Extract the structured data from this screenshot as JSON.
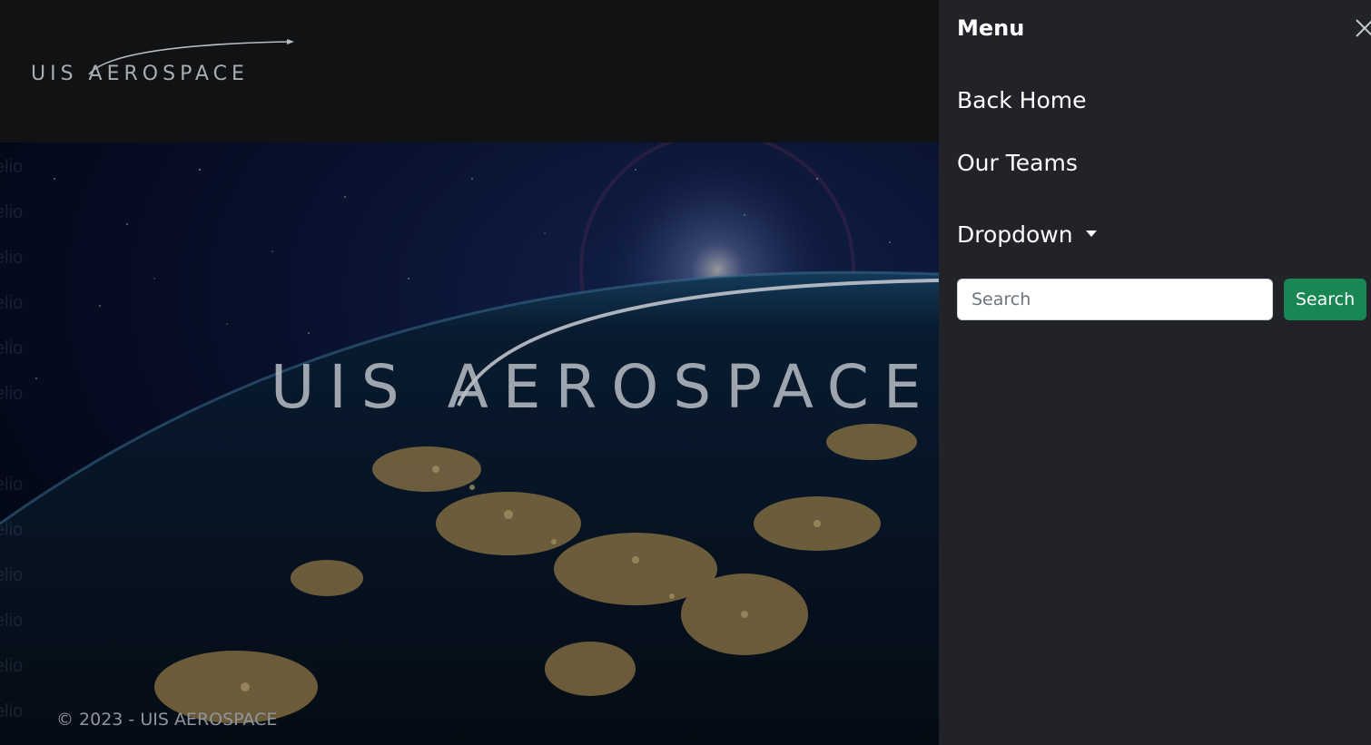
{
  "header": {
    "logo_text": "UIS AEROSPACE"
  },
  "hero": {
    "logo_text": "UIS AEROSPACE",
    "ghost_fragment": "elio"
  },
  "footer": {
    "copyright": "© 2023 - UIS AEROSPACE"
  },
  "offcanvas": {
    "title": "Menu",
    "close_icon": "close-icon",
    "links": [
      {
        "label": "Back Home"
      },
      {
        "label": "Our Teams"
      }
    ],
    "dropdown": {
      "label": "Dropdown",
      "icon": "caret-down-icon"
    },
    "search": {
      "placeholder": "Search",
      "button_label": "Search",
      "button_color": "#198754"
    }
  },
  "colors": {
    "header_bg": "#111214",
    "offcanvas_bg": "#212328",
    "accent": "#198754"
  }
}
